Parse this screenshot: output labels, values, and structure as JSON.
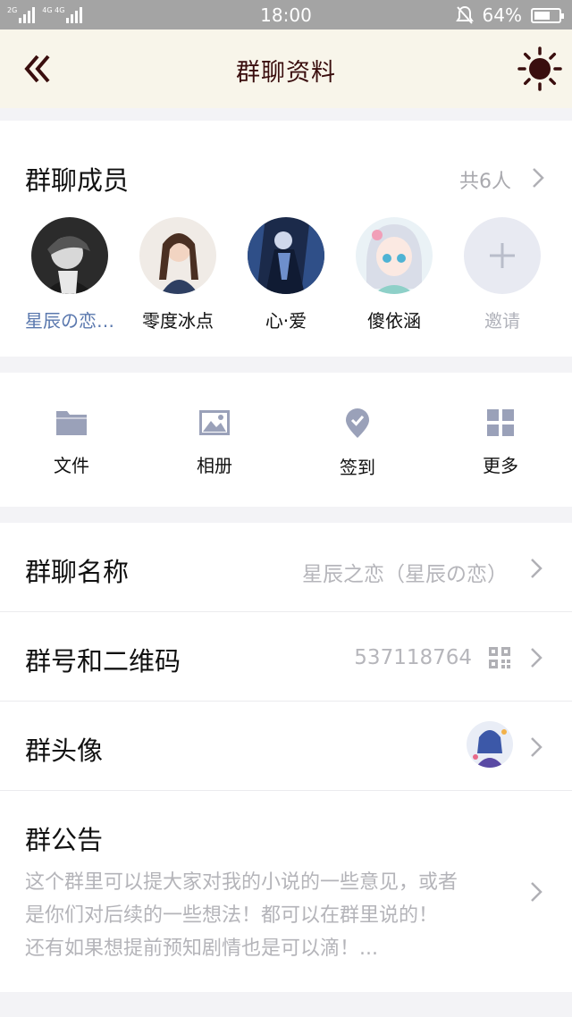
{
  "status_bar": {
    "sim1_label": "2G",
    "sim2_label": "4G 4G",
    "time": "18:00",
    "battery_text": "64%",
    "battery_level": 0.64,
    "icons": [
      "bell-muted-icon",
      "battery-icon"
    ]
  },
  "header": {
    "title": "群聊资料",
    "back_icon": "double-chevron-left-icon",
    "theme_icon": "sun-icon",
    "accent_color": "#3a0e0e",
    "background": "#f8f5ea"
  },
  "members": {
    "title": "群聊成员",
    "count_text": "共6人",
    "list": [
      {
        "name": "星辰の恋…",
        "highlight": true
      },
      {
        "name": "零度冰点",
        "highlight": false
      },
      {
        "name": "心·爱",
        "highlight": false
      },
      {
        "name": "傻依涵",
        "highlight": false
      }
    ],
    "invite_label": "邀请"
  },
  "actions": [
    {
      "label": "文件",
      "icon": "folder-icon"
    },
    {
      "label": "相册",
      "icon": "image-icon"
    },
    {
      "label": "签到",
      "icon": "checkin-pin-icon"
    },
    {
      "label": "更多",
      "icon": "grid-icon"
    }
  ],
  "settings": {
    "name_row": {
      "label": "群聊名称",
      "value": "星辰之恋（星辰の恋）"
    },
    "number_row": {
      "label": "群号和二维码",
      "value": "537118764",
      "icon": "qr-code-icon"
    },
    "avatar_row": {
      "label": "群头像",
      "icon": "group-avatar-thumbnail"
    },
    "notice_row": {
      "label": "群公告",
      "lines": [
        "这个群里可以提大家对我的小说的一些意见，或者",
        "是你们对后续的一些想法！都可以在群里说的！",
        "还有如果想提前预知剧情也是可以滴！..."
      ]
    }
  },
  "colors": {
    "icon_gray": "#9aa1b9",
    "muted_text": "#b6b6bb",
    "link_blue": "#5a78ae"
  }
}
